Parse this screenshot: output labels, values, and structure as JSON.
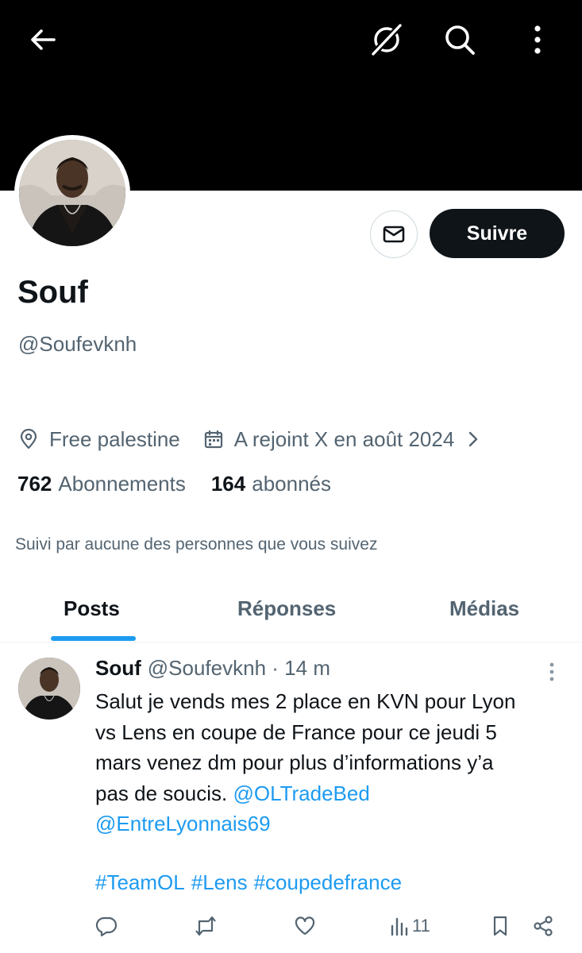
{
  "profile": {
    "display_name": "Souf",
    "handle": "@Soufevknh",
    "location": "Free palestine",
    "joined": "A rejoint X en août 2024",
    "following_count": "762",
    "following_label": "Abonnements",
    "followers_count": "164",
    "followers_label": "abonnés",
    "followed_by": "Suivi par aucune des personnes que vous suivez"
  },
  "buttons": {
    "follow": "Suivre"
  },
  "icons": {
    "back": "arrow-left-icon",
    "grok": "grok-icon",
    "search": "search-icon",
    "more": "more-vertical-icon",
    "message": "envelope-icon",
    "location": "location-pin-icon",
    "calendar": "calendar-icon"
  },
  "tabs": [
    {
      "label": "Posts",
      "active": true
    },
    {
      "label": "Réponses",
      "active": false
    },
    {
      "label": "Médias",
      "active": false
    }
  ],
  "post": {
    "author": "Souf",
    "handle": "@Soufevknh",
    "separator": "·",
    "time": "14 m",
    "lines": [
      "Salut je vends mes 2 place en KVN pour Lyon",
      "vs Lens en coupe de France pour ce jeudi 5",
      "mars venez dm pour plus d’informations y’a"
    ],
    "line4_text": "pas de soucis.",
    "mention1": "@OLTradeBed",
    "mention2": "@EntreLyonnais69",
    "hashtags": [
      "#TeamOL",
      "#Lens",
      "#coupedefrance"
    ],
    "views": "11"
  },
  "colors": {
    "accent": "#1d9bf0",
    "text_primary": "#0f1419",
    "text_secondary": "#536471",
    "banner": "#000000"
  }
}
